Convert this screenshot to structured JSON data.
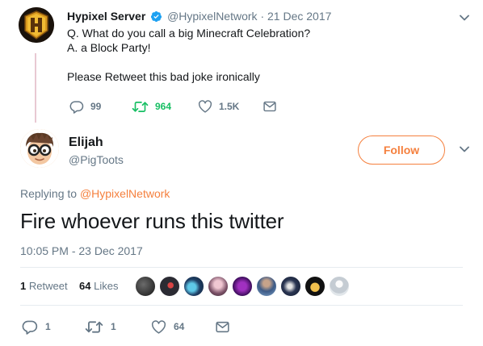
{
  "parent_tweet": {
    "display_name": "Hypixel Server",
    "verified_icon": "verified-badge-icon",
    "handle": "@HypixelNetwork",
    "separator": "·",
    "date": "21 Dec 2017",
    "lines": [
      "Q. What do you call a big Minecraft Celebration?",
      "A. a Block Party!",
      "",
      "Please Retweet this bad joke ironically"
    ],
    "actions": {
      "reply_count": "99",
      "retweet_count": "964",
      "like_count": "1.5K"
    },
    "avatar_letter": "H"
  },
  "main_tweet": {
    "display_name": "Elijah",
    "handle": "@PigToots",
    "follow_label": "Follow",
    "replying_prefix": "Replying to",
    "replying_mention": "@HypixelNetwork",
    "text": "Fire whoever runs this twitter",
    "timestamp": "10:05 PM - 23 Dec 2017",
    "stats": {
      "retweets_count": "1",
      "retweets_label": "Retweet",
      "likes_count": "64",
      "likes_label": "Likes"
    },
    "actions": {
      "reply_count": "1",
      "retweet_count": "1",
      "like_count": "64"
    }
  },
  "colors": {
    "accent": "#f5803e",
    "retweet_green": "#17bf63",
    "verified_blue": "#1da1f2",
    "muted_text": "#657786",
    "thread_line": "#e8c9d3"
  },
  "icons": [
    "reply-icon",
    "retweet-icon",
    "heart-icon",
    "mail-icon",
    "chevron-down-icon",
    "verified-badge-icon"
  ]
}
